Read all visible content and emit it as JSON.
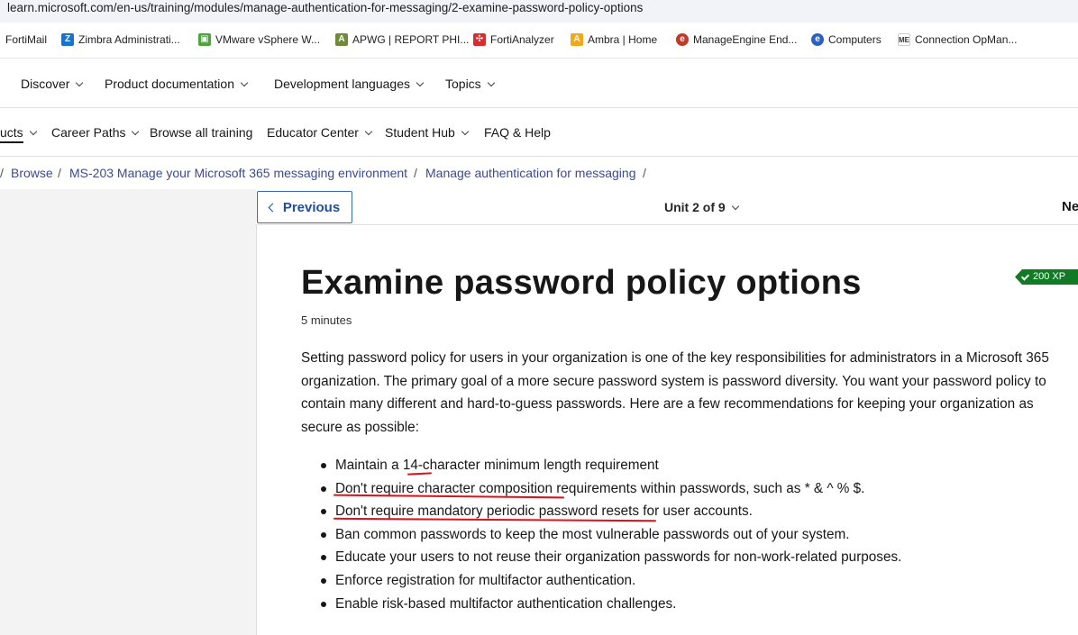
{
  "browser": {
    "url": "learn.microsoft.com/en-us/training/modules/manage-authentication-for-messaging/2-examine-password-policy-options",
    "bookmarks": [
      {
        "label": "FortiMail",
        "icon": "fortimail-icon"
      },
      {
        "label": "Zimbra Administrati...",
        "icon": "zimbra-icon",
        "color": "#1a73c9"
      },
      {
        "label": "VMware vSphere W...",
        "icon": "vmware-icon",
        "color": "#4ba53a"
      },
      {
        "label": "APWG | REPORT PHI...",
        "icon": "apwg-icon",
        "color": "#6e8a3a"
      },
      {
        "label": "FortiAnalyzer",
        "icon": "fortinet-icon",
        "color": "#da2c2c"
      },
      {
        "label": "Ambra | Home",
        "icon": "ambra-icon",
        "color": "#f0a81c"
      },
      {
        "label": "ManageEngine End...",
        "icon": "manageengine-icon",
        "color": "#c0392b"
      },
      {
        "label": "Computers",
        "icon": "manageengine-icon",
        "color": "#2b5fc0"
      },
      {
        "label": "Connection OpMan...",
        "icon": "me-icon",
        "color": "#333333"
      }
    ]
  },
  "nav_primary": [
    {
      "label": "Discover"
    },
    {
      "label": "Product documentation"
    },
    {
      "label": "Development languages"
    },
    {
      "label": "Topics"
    }
  ],
  "nav_secondary": [
    {
      "label": "ucts"
    },
    {
      "label": "Career Paths"
    },
    {
      "label": "Browse all training"
    },
    {
      "label": "Educator Center"
    },
    {
      "label": "Student Hub"
    },
    {
      "label": "FAQ & Help"
    }
  ],
  "breadcrumb": {
    "items": [
      "Browse",
      "MS-203 Manage your Microsoft 365 messaging environment",
      "Manage authentication for messaging"
    ],
    "separator": "/"
  },
  "unit_nav": {
    "previous_label": "Previous",
    "unit_label": "Unit 2 of 9",
    "next_label": "Ne"
  },
  "article": {
    "title": "Examine password policy options",
    "xp_badge": "200 XP",
    "duration": "5 minutes",
    "intro": "Setting password policy for users in your organization is one of the key responsibilities for administrators in a Microsoft 365 organization. The primary goal of a more secure password system is password diversity. You want your password policy to contain many different and hard-to-guess passwords. Here are a few recommendations for keeping your organization as secure as possible:",
    "recommendations": [
      "Maintain a 14-character minimum length requirement",
      "Don't require character composition requirements within passwords, such as * & ^ % $.",
      "Don't require mandatory periodic password resets for user accounts.",
      "Ban common passwords to keep the most vulnerable passwords out of your system.",
      "Educate your users to not reuse their organization passwords for non-work-related purposes.",
      "Enforce registration for multifactor authentication.",
      "Enable risk-based multifactor authentication challenges."
    ]
  },
  "colors": {
    "link": "#3d4a8f",
    "xp_badge": "#117a24",
    "annotation_underline": "#e0101a"
  }
}
